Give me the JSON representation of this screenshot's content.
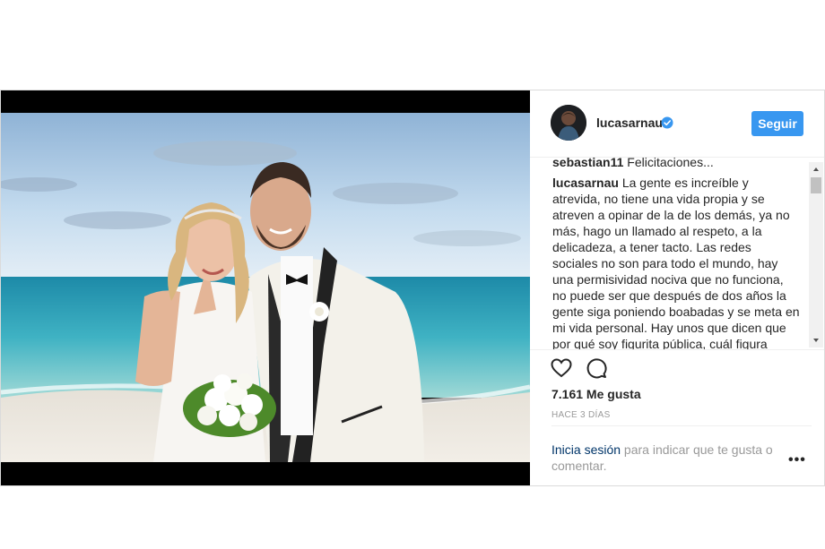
{
  "post": {
    "username": "lucasarnau",
    "follow_label": "Seguir",
    "previous_comment": {
      "username": "sebastian11",
      "text": "Felicitaciones..."
    },
    "caption": {
      "username": "lucasarnau",
      "text": "La gente es increíble y atrevida, no tiene una vida propia y se atreven a opinar de la de los demás, ya no más, hago un llamado al respeto, a la delicadeza, a tener tacto. Las redes sociales no son para todo el mundo, hay una permisividad nociva que no funciona, no puede ser que después de dos años la gente siga poniendo boabadas y se meta en mi vida personal. Hay unos que dicen que por qué soy figurita pública, cuál figura pública ni"
    },
    "likes": "7.161 Me gusta",
    "time_ago": "HACE 3 DÍAS",
    "login": {
      "link_text": "Inicia sesión",
      "rest_text": " para indicar que te gusta o comentar."
    },
    "more_label": "•••"
  },
  "colors": {
    "accent": "#3897f0",
    "link": "#003569",
    "muted": "#999999",
    "text": "#262626",
    "media_bg": "#000000"
  },
  "icons": [
    "verified-badge-icon",
    "heart-icon",
    "comment-icon",
    "scroll-up-arrow-icon",
    "scroll-down-arrow-icon",
    "more-options-icon"
  ]
}
